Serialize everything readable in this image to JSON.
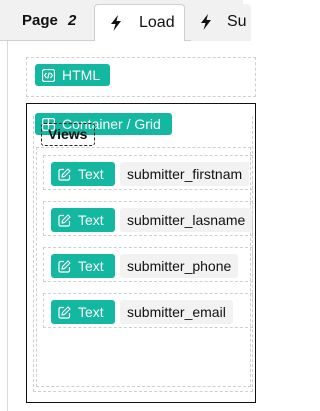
{
  "tabbar": {
    "page_label": "Page",
    "page_number": "2",
    "tabs": [
      {
        "label": "Load",
        "icon": "bolt-icon"
      },
      {
        "label": "Su",
        "icon": "bolt-icon"
      }
    ]
  },
  "blocks": {
    "html_badge": "HTML",
    "container_badge": "Container / Grid",
    "views_label": "Views",
    "rows": [
      {
        "type": "Text",
        "field": "submitter_firstnam"
      },
      {
        "type": "Text",
        "field": "submitter_lasname"
      },
      {
        "type": "Text",
        "field": "submitter_phone"
      },
      {
        "type": "Text",
        "field": "submitter_email"
      }
    ]
  },
  "colors": {
    "accent": "#14b8a0"
  }
}
